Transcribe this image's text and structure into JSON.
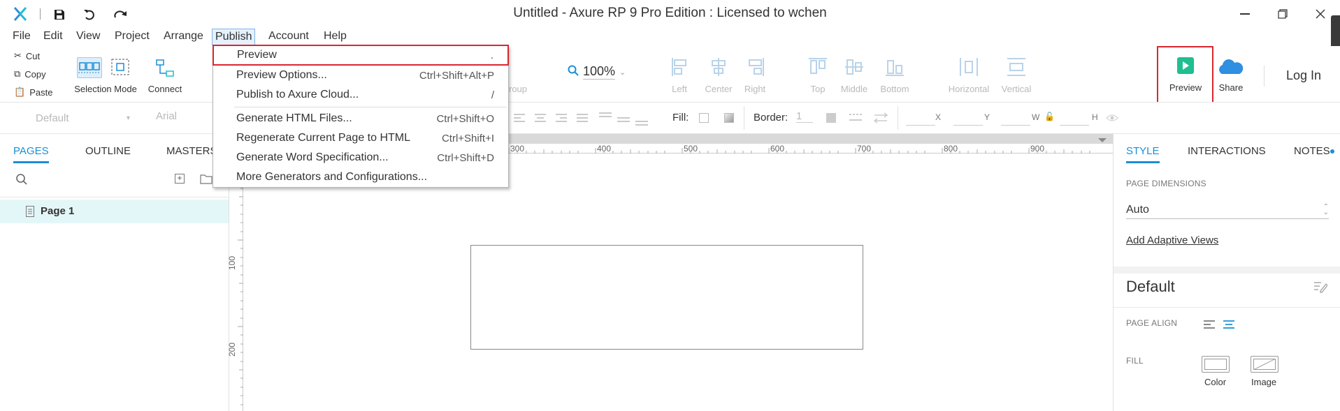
{
  "window": {
    "title": "Untitled - Axure RP 9 Pro Edition : Licensed to wchen",
    "controls": [
      "minimize",
      "restore",
      "close"
    ]
  },
  "menubar": [
    "File",
    "Edit",
    "View",
    "Project",
    "Arrange",
    "Publish",
    "Account",
    "Help"
  ],
  "toolbar": {
    "cut": "Cut",
    "copy": "Copy",
    "paste": "Paste",
    "selection_mode": "Selection Mode",
    "connect": "Connect",
    "group_partial": "roup",
    "zoom": "100%",
    "align": [
      "Left",
      "Center",
      "Right",
      "Top",
      "Middle",
      "Bottom"
    ],
    "distribute": [
      "Horizontal",
      "Vertical"
    ],
    "preview": "Preview",
    "share": "Share",
    "login": "Log In"
  },
  "stylebar": {
    "style_select": "Default",
    "font_select": "Arial",
    "fill_label": "Fill:",
    "border_label": "Border:",
    "border_value": "1",
    "coord_labels": [
      "X",
      "Y",
      "W",
      "H"
    ]
  },
  "left_panel": {
    "tabs": [
      "PAGES",
      "OUTLINE",
      "MASTERS"
    ],
    "pages": [
      "Page 1"
    ]
  },
  "ruler": {
    "top_labels": [
      "300",
      "400",
      "500",
      "600",
      "700",
      "800",
      "900"
    ],
    "left_labels": [
      "100",
      "200"
    ]
  },
  "right_panel": {
    "tabs": [
      "STYLE",
      "INTERACTIONS",
      "NOTES"
    ],
    "page_dimensions_label": "PAGE DIMENSIONS",
    "page_dimensions_value": "Auto",
    "add_adaptive_views": "Add Adaptive Views",
    "style_name": "Default",
    "page_align_label": "PAGE ALIGN",
    "fill_label": "FILL",
    "fill_color": "Color",
    "fill_image": "Image"
  },
  "publish_menu": {
    "items": [
      {
        "label": "Preview",
        "shortcut": "."
      },
      {
        "label": "Preview Options...",
        "shortcut": "Ctrl+Shift+Alt+P"
      },
      {
        "label": "Publish to Axure Cloud...",
        "shortcut": "/"
      },
      {
        "label": "Generate HTML Files...",
        "shortcut": "Ctrl+Shift+O"
      },
      {
        "label": "Regenerate Current Page to HTML",
        "shortcut": "Ctrl+Shift+I"
      },
      {
        "label": "Generate Word Specification...",
        "shortcut": "Ctrl+Shift+D"
      },
      {
        "label": "More Generators and Configurations...",
        "shortcut": ""
      }
    ]
  },
  "colors": {
    "accent": "#1a8fd6",
    "preview_green": "#1fbf8f",
    "highlight_red": "#d9262e",
    "logo_blue": "#2f8fe0"
  }
}
